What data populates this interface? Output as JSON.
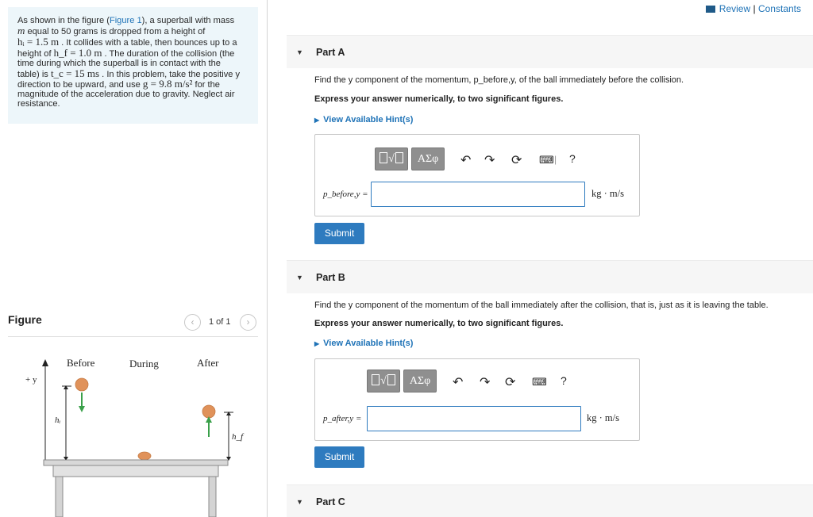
{
  "header": {
    "review_link": "Review",
    "separator": "|",
    "constants_link": "Constants"
  },
  "problem": {
    "lines": [
      {
        "pre": "As shown in the figure (",
        "link": "Figure 1",
        "post": "), a superball with mass"
      },
      {
        "m": "m",
        "post": " equal to 50 grams is dropped from a height of"
      },
      {
        "m": "hᵢ = 1.5 m",
        "post": " . It collides with a table, then bounces up to a"
      },
      {
        "pre": "height of  ",
        "m": "h_f  = 1.0 m",
        "post": " . The duration of the collision (the"
      },
      {
        "pre": "time during which the superball is in contact with the"
      },
      {
        "pre": "table) is ",
        "m": "t_c = 15 ms",
        "post": " . In this problem, take the positive y"
      },
      {
        "pre": "direction to be upward, and use ",
        "m": "g = 9.8 m/s²",
        "post": " for the"
      },
      {
        "pre": "magnitude of the acceleration due to gravity. Neglect air"
      },
      {
        "pre": "resistance."
      }
    ]
  },
  "figure": {
    "title": "Figure",
    "count": "1 of 1",
    "prev_icon": "‹",
    "next_icon": "›",
    "labels": {
      "before": "Before",
      "during": "During",
      "after": "After",
      "axis": "+ y",
      "hi": "hᵢ",
      "hf": "h_f"
    }
  },
  "parts": [
    {
      "title": "Part A",
      "question": "Find the y component of the momentum, p_before,y, of the ball immediately before the collision.",
      "instruction": "Express your answer numerically, to two significant figures.",
      "hint": "View Available Hint(s)",
      "label": "p_before,y =",
      "value": "",
      "unit": "kg · m/s",
      "submit": "Submit",
      "toolbar": {
        "greek": "ΑΣφ",
        "help": "?"
      }
    },
    {
      "title": "Part B",
      "question": "Find the y component of the momentum of the ball immediately after the collision, that is, just as it is leaving the table.",
      "instruction": "Express your answer numerically, to two significant figures.",
      "hint": "View Available Hint(s)",
      "label": "p_after,y =",
      "value": "",
      "unit": "kg · m/s",
      "submit": "Submit",
      "toolbar": {
        "greek": "ΑΣφ",
        "help": "?"
      }
    },
    {
      "title": "Part C"
    }
  ],
  "colors": {
    "accent": "#2e7bbf",
    "link": "#1f73b7",
    "problem_bg": "#edf6fa",
    "ball": "#e0925a",
    "arrow": "#3aa04a"
  }
}
